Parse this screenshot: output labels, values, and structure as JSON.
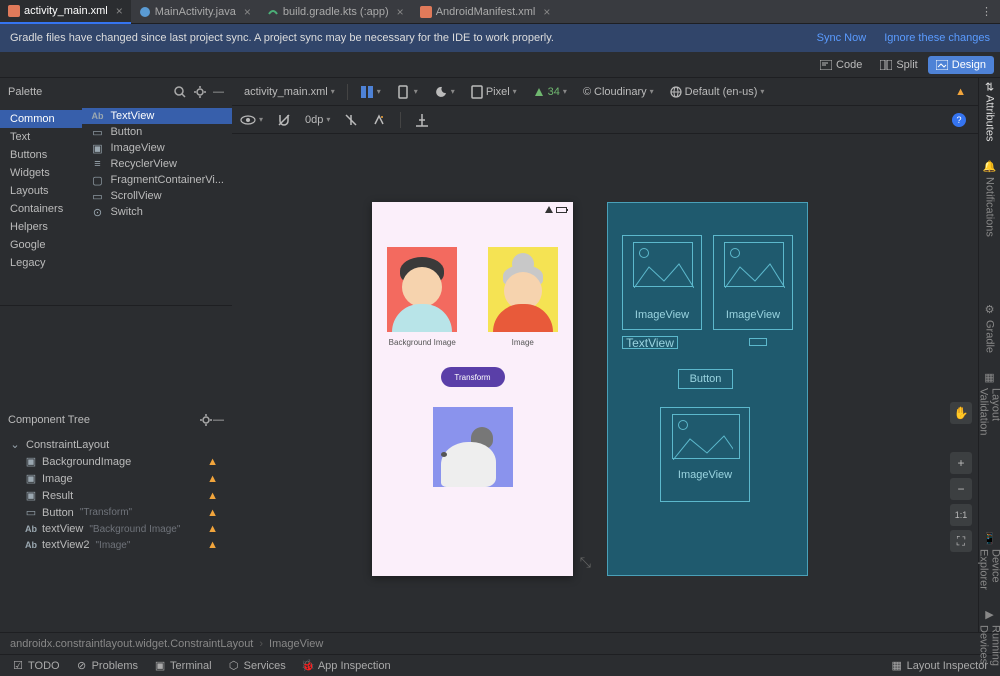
{
  "tabs": [
    {
      "label": "activity_main.xml",
      "active": true,
      "icon": "#e07a5a"
    },
    {
      "label": "MainActivity.java",
      "active": false,
      "icon": "#5a9bd4"
    },
    {
      "label": "build.gradle.kts (:app)",
      "active": false,
      "icon": "#4caf78"
    },
    {
      "label": "AndroidManifest.xml",
      "active": false,
      "icon": "#e07a5a"
    }
  ],
  "sync": {
    "msg": "Gradle files have changed since last project sync. A project sync may be necessary for the IDE to work properly.",
    "now": "Sync Now",
    "ignore": "Ignore these changes"
  },
  "viewmodes": {
    "code": "Code",
    "split": "Split",
    "design": "Design"
  },
  "palette": {
    "title": "Palette",
    "cats": [
      "Common",
      "Text",
      "Buttons",
      "Widgets",
      "Layouts",
      "Containers",
      "Helpers",
      "Google",
      "Legacy"
    ],
    "items": [
      {
        "label": "TextView",
        "icon": "Ab"
      },
      {
        "label": "Button",
        "icon": "▭"
      },
      {
        "label": "ImageView",
        "icon": "▣"
      },
      {
        "label": "RecyclerView",
        "icon": "≡"
      },
      {
        "label": "FragmentContainerVi...",
        "icon": "▢"
      },
      {
        "label": "ScrollView",
        "icon": "▭"
      },
      {
        "label": "Switch",
        "icon": "⊙"
      }
    ]
  },
  "tree": {
    "title": "Component Tree",
    "root": "ConstraintLayout",
    "items": [
      {
        "label": "BackgroundImage",
        "icon": "▣",
        "warn": true
      },
      {
        "label": "Image",
        "icon": "▣",
        "warn": true
      },
      {
        "label": "Result",
        "icon": "▣",
        "warn": true
      },
      {
        "label": "Button",
        "sub": "\"Transform\"",
        "icon": "▭",
        "warn": true
      },
      {
        "label": "textView",
        "sub": "\"Background Image\"",
        "icon": "Ab",
        "warn": true
      },
      {
        "label": "textView2",
        "sub": "\"Image\"",
        "icon": "Ab",
        "warn": true
      }
    ]
  },
  "dtoolbar": {
    "file": "activity_main.xml",
    "device": "Pixel",
    "api": "34",
    "theme": "Cloudinary",
    "locale": "Default (en-us)"
  },
  "dtool2": {
    "dp": "0dp"
  },
  "device": {
    "label1": "Background Image",
    "label2": "Image",
    "button": "Transform"
  },
  "blueprint": {
    "imgview": "ImageView",
    "textview": "TextView",
    "button": "Button"
  },
  "rightpanels": [
    "Attributes",
    "Notifications",
    "Gradle",
    "Layout Validation",
    "Device Explorer",
    "Running Devices"
  ],
  "breadcrumb": {
    "a": "androidx.constraintlayout.widget.ConstraintLayout",
    "b": "ImageView"
  },
  "bottom": [
    "TODO",
    "Problems",
    "Terminal",
    "Services",
    "App Inspection"
  ],
  "bottom_right": "Layout Inspector"
}
